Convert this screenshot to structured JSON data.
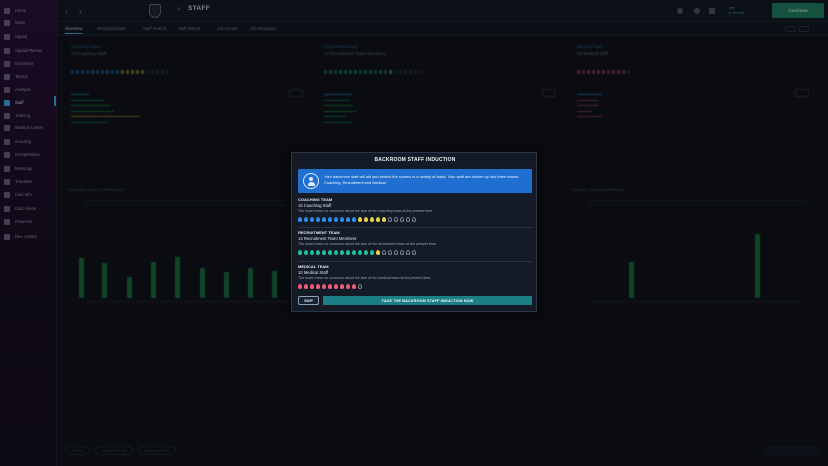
{
  "header": {
    "title": "STAFF",
    "continue_label": "Continue"
  },
  "sidebar": {
    "items": [
      {
        "label": "Home"
      },
      {
        "label": "Inbox"
      },
      {
        "label": "Squad"
      },
      {
        "label": "Squad Planner"
      },
      {
        "label": "Dynamics"
      },
      {
        "label": "Tactics"
      },
      {
        "label": "Analysis"
      },
      {
        "label": "Staff"
      },
      {
        "label": "Training"
      },
      {
        "label": "Medical Centre"
      },
      {
        "label": "Scouting"
      },
      {
        "label": "Competitions"
      },
      {
        "label": "Meetings"
      },
      {
        "label": "Transfers"
      },
      {
        "label": "Club Info"
      },
      {
        "label": "Club Vision"
      },
      {
        "label": "Finances"
      },
      {
        "label": "Dev. Centre"
      }
    ]
  },
  "tabs": [
    "Overview",
    "Responsibilities",
    "Staff Search",
    "Staff Report",
    "Job Centre",
    "Job Requests"
  ],
  "background": {
    "columns": [
      {
        "title": "Coaching Team",
        "subtitle": "15 Coaching Staff"
      },
      {
        "title": "Recruitment Team",
        "subtitle": "14 Recruitment Team Members"
      },
      {
        "title": "Medical Team",
        "subtitle": "10 Medical Staff"
      }
    ],
    "chart_headers": [
      "COACHING TEAM COMPARISON",
      "MEDICAL TEAM COMPARISON"
    ]
  },
  "modal": {
    "title": "BACKROOM STAFF INDUCTION",
    "info": "Your backroom staff will aid you behind the scenes in a variety of tasks. Your staff are broken up into three teams: Coaching, Recruitment and Medical.",
    "sections": [
      {
        "heading": "COACHING TEAM",
        "name": "15 Coaching Staff",
        "desc": "The board have no concerns about the size of the coaching team at the present time.",
        "filled": 15,
        "total": 20,
        "colors": [
          "#2f8ff0",
          "#2f8ff0",
          "#2f8ff0",
          "#2f8ff0",
          "#2f8ff0",
          "#2f8ff0",
          "#2f8ff0",
          "#2f8ff0",
          "#2f8ff0",
          "#2f8ff0",
          "#e6d34a",
          "#e6d34a",
          "#e6d34a",
          "#e6d34a",
          "#e6d34a"
        ]
      },
      {
        "heading": "RECRUITMENT TEAM",
        "name": "14 Recruitment Team Members",
        "desc": "The board have no concerns about the size of the recruitment team at the present time.",
        "filled": 14,
        "total": 20,
        "colors": [
          "#1fbfa0",
          "#1fbfa0",
          "#1fbfa0",
          "#1fbfa0",
          "#1fbfa0",
          "#1fbfa0",
          "#1fbfa0",
          "#1fbfa0",
          "#1fbfa0",
          "#1fbfa0",
          "#1fbfa0",
          "#1fbfa0",
          "#1fbfa0",
          "#e6d34a"
        ]
      },
      {
        "heading": "MEDICAL TEAM",
        "name": "10 Medical Staff",
        "desc": "The board have no concerns about the size of the medical team at the present time.",
        "filled": 10,
        "total": 11,
        "colors": [
          "#ef5b7a",
          "#ef5b7a",
          "#ef5b7a",
          "#ef5b7a",
          "#ef5b7a",
          "#ef5b7a",
          "#ef5b7a",
          "#ef5b7a",
          "#ef5b7a",
          "#ef5b7a"
        ]
      }
    ],
    "skip_label": "SKIP",
    "take_label": "TAKE THE BACKROOM STAFF INDUCTION NOW"
  }
}
